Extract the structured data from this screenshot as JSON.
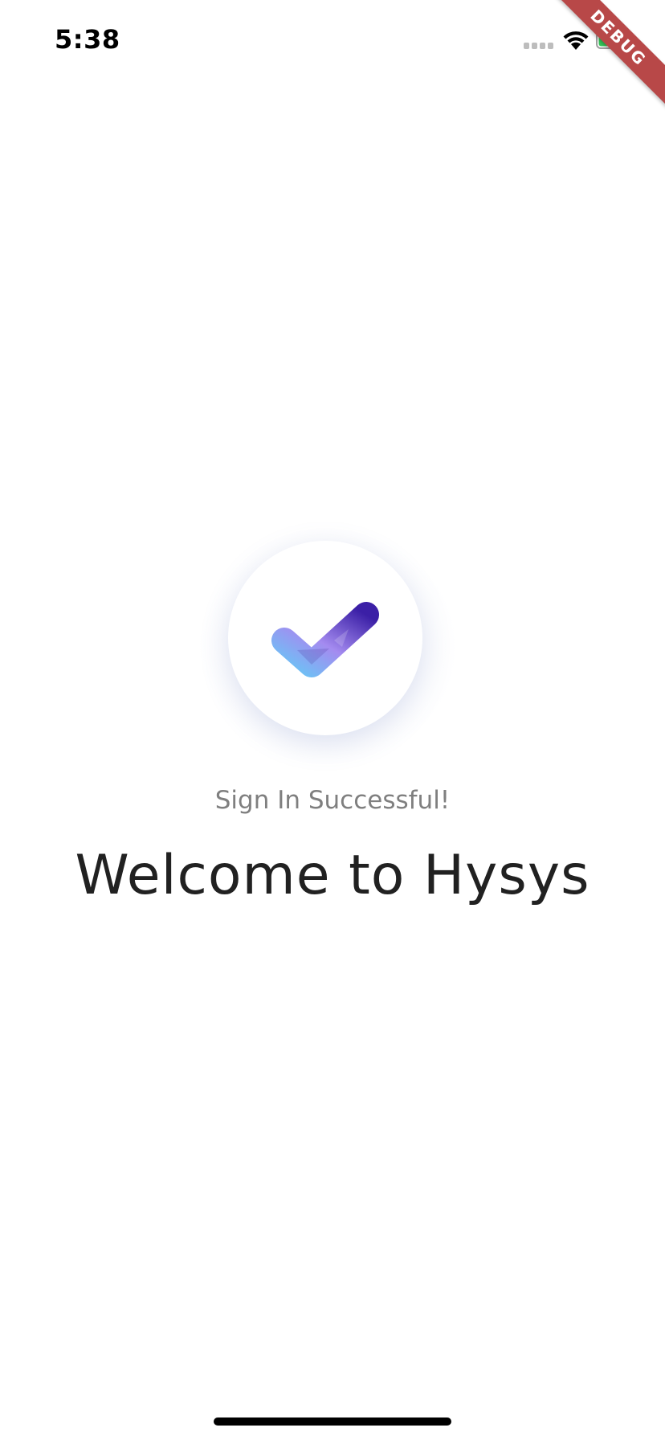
{
  "status_bar": {
    "time": "5:38",
    "signal_icon": "cellular-signal-icon",
    "wifi_icon": "wifi-icon",
    "battery_icon": "battery-charging-icon",
    "battery_color": "#34c759"
  },
  "debug_banner": {
    "label": "DEBUG",
    "color": "#b84848"
  },
  "success": {
    "icon": "checkmark-icon",
    "subtitle": "Sign In Successful!",
    "title": "Welcome to Hysys"
  },
  "colors": {
    "check_light": "#6ec1f5",
    "check_mid": "#a48bf0",
    "check_dark": "#3b1fa6",
    "subtitle_text": "#7f7f7f",
    "title_text": "#212121"
  }
}
